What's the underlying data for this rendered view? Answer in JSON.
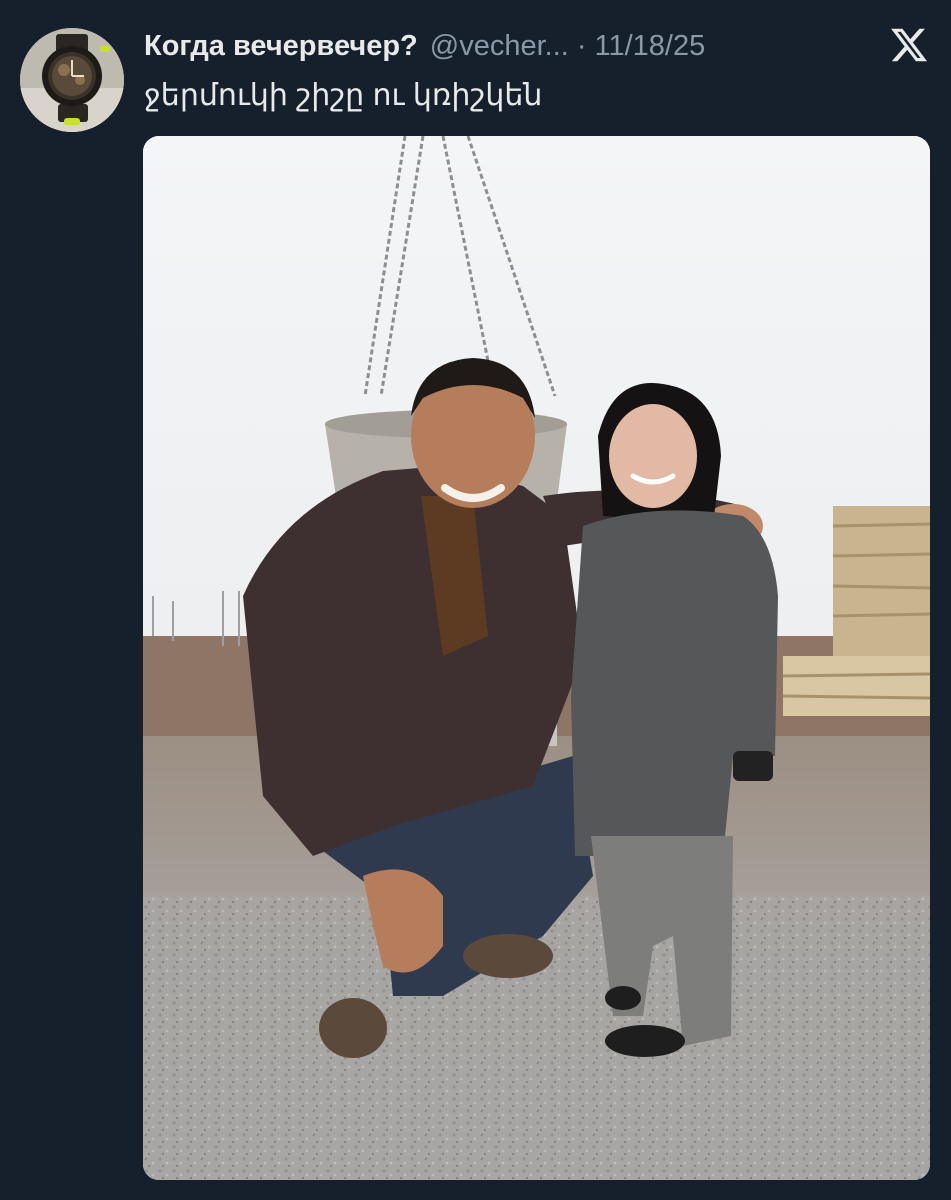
{
  "tweet": {
    "author": {
      "display_name": "Когда вечервечер?",
      "handle": "@vecher...",
      "avatar_icon": "watch-avatar-icon"
    },
    "separator": "·",
    "date": "11/18/25",
    "text": "ջերմուկի շիշը ու կռիշկեն",
    "platform_icon": "x-logo-icon",
    "media": {
      "type": "photo",
      "icon": "photo-two-people-construction-site"
    }
  },
  "colors": {
    "background": "#16202c",
    "primary_text": "#e7e9ea",
    "secondary_text": "#8b98a5"
  }
}
